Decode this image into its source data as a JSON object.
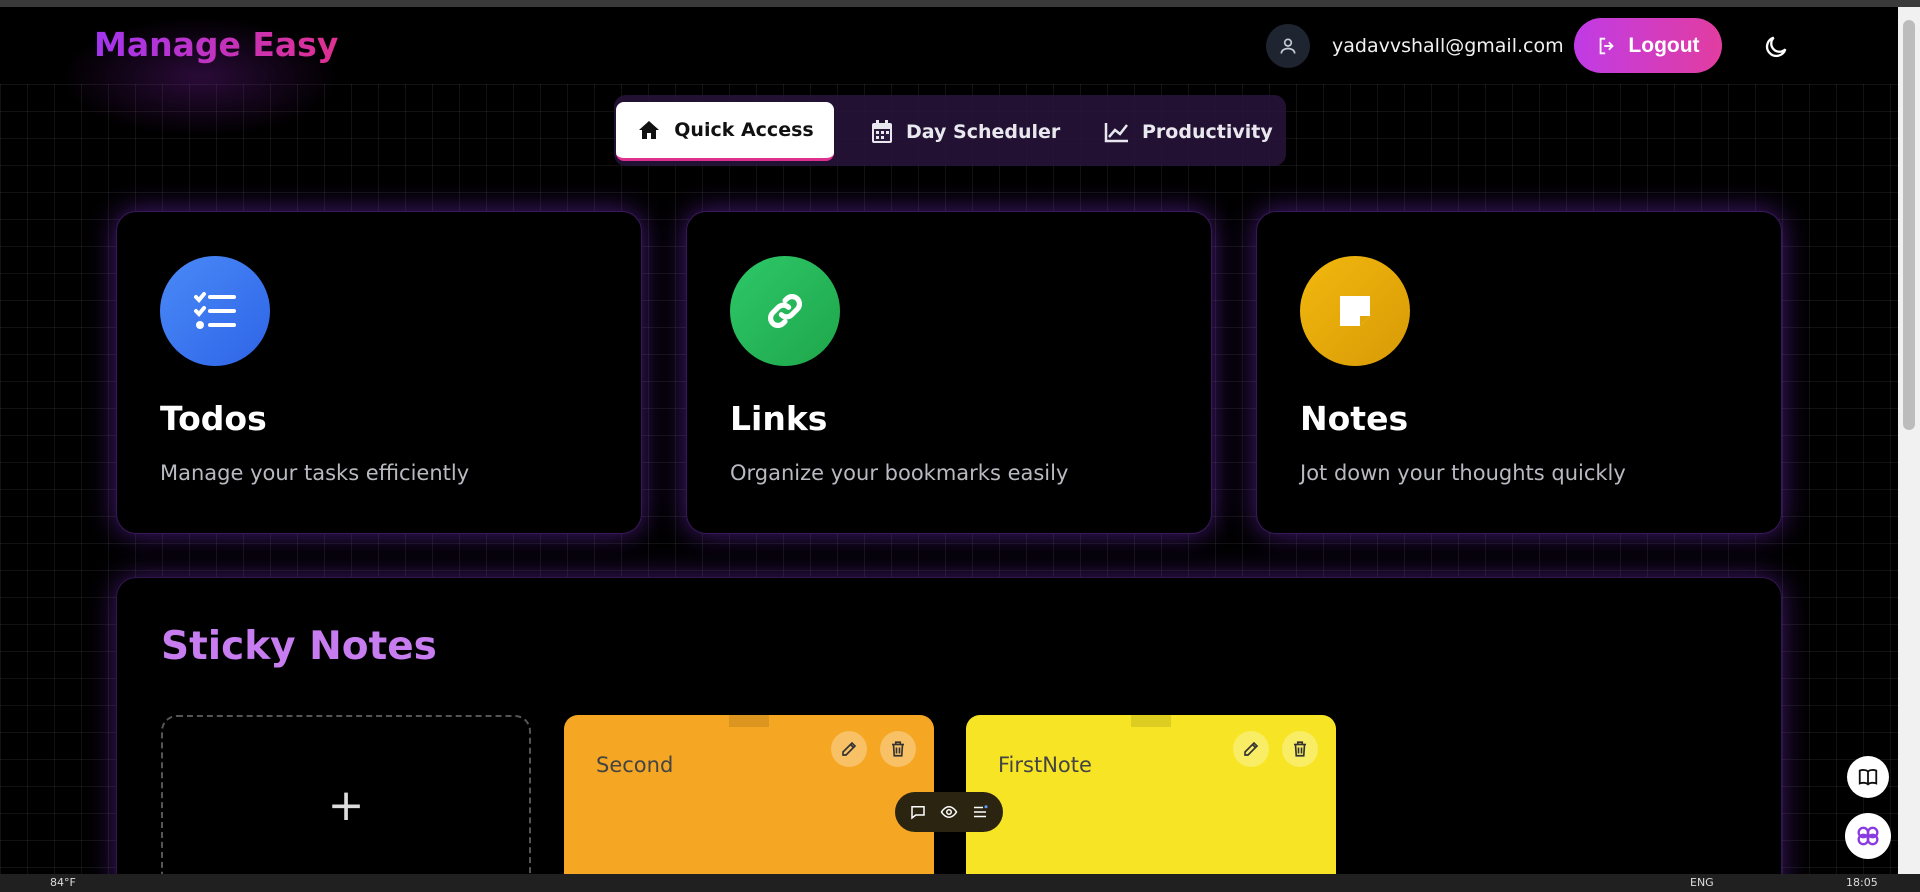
{
  "header": {
    "brand": "Manage Easy",
    "email": "yadavvshall@gmail.com",
    "logout_label": "Logout"
  },
  "tabs": [
    {
      "label": "Quick Access",
      "icon": "home-icon",
      "active": true
    },
    {
      "label": "Day Scheduler",
      "icon": "calendar-icon",
      "active": false
    },
    {
      "label": "Productivity",
      "icon": "chart-line-icon",
      "active": false
    }
  ],
  "cards": [
    {
      "title": "Todos",
      "desc": "Manage your tasks efficiently",
      "color": "#3b7cf6",
      "icon": "checklist-icon"
    },
    {
      "title": "Links",
      "desc": "Organize your bookmarks easily",
      "color": "#22b856",
      "icon": "link-icon"
    },
    {
      "title": "Notes",
      "desc": "Jot down your thoughts quickly",
      "color": "#e8aa0a",
      "icon": "sticky-note-icon"
    }
  ],
  "sticky": {
    "title": "Sticky Notes",
    "add_symbol": "+",
    "notes": [
      {
        "text": "Second",
        "color": "#f5a623"
      },
      {
        "text": "FirstNote",
        "color": "#f7e525"
      }
    ]
  },
  "taskbar": {
    "weather": "84°F",
    "lang": "ENG",
    "time": "18:05"
  }
}
